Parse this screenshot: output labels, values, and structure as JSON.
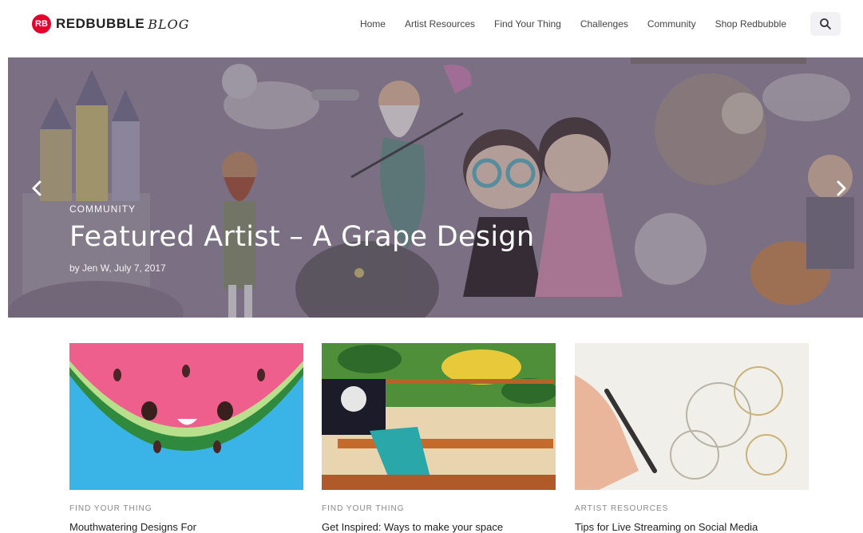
{
  "brand": {
    "logo_text": "REDBUBBLE",
    "logo_suffix": "BLOG",
    "logo_badge": "RB",
    "accent": "#e4002b"
  },
  "nav": {
    "items": [
      {
        "label": "Home"
      },
      {
        "label": "Artist Resources"
      },
      {
        "label": "Find Your Thing"
      },
      {
        "label": "Challenges"
      },
      {
        "label": "Community"
      },
      {
        "label": "Shop Redbubble"
      }
    ],
    "search_icon": "search-icon"
  },
  "hero": {
    "category": "COMMUNITY",
    "title": "Featured Artist – A Grape Design",
    "meta": "by Jen W, July 7, 2017",
    "prev_icon": "chevron-left-icon",
    "next_icon": "chevron-right-icon"
  },
  "posts": [
    {
      "category": "FIND YOUR THING",
      "title": "Mouthwatering Designs For"
    },
    {
      "category": "FIND YOUR THING",
      "title": "Get Inspired: Ways to make your space"
    },
    {
      "category": "ARTIST RESOURCES",
      "title": "Tips for Live Streaming on Social Media"
    }
  ]
}
